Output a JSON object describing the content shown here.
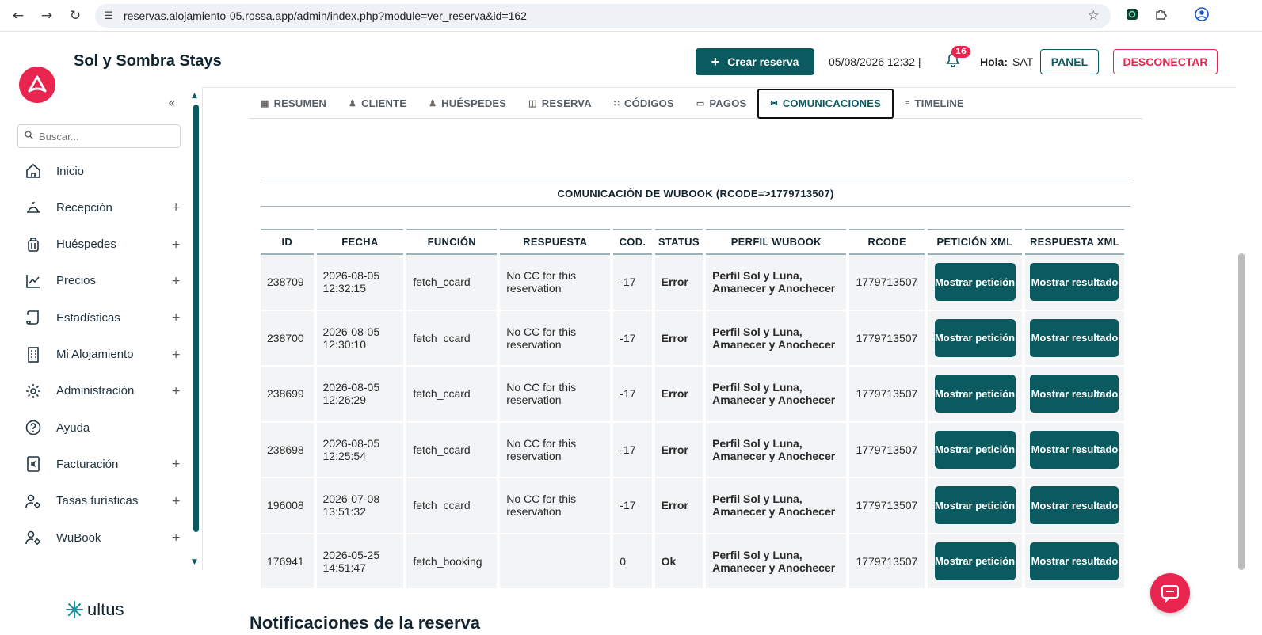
{
  "browser": {
    "url": "reservas.alojamiento-05.rossa.app/admin/index.php?module=ver_reserva&id=162"
  },
  "header": {
    "site_title": "Sol y Sombra Stays",
    "create_label": "Crear reserva",
    "datetime": "05/08/2026 12:32 |",
    "notifications_count": "16",
    "greeting": "Hola:",
    "user": "SAT",
    "panel_label": "PANEL",
    "logout_label": "DESCONECTAR",
    "colors": {
      "primary": "#0b5a60",
      "accent": "#e8254e"
    }
  },
  "sidebar": {
    "search_placeholder": "Buscar...",
    "items": [
      {
        "label": "Inicio",
        "icon": "home-icon",
        "expandable": false
      },
      {
        "label": "Recepción",
        "icon": "reception-bell-icon",
        "expandable": true
      },
      {
        "label": "Huéspedes",
        "icon": "luggage-icon",
        "expandable": true
      },
      {
        "label": "Precios",
        "icon": "chart-line-icon",
        "expandable": true
      },
      {
        "label": "Estadísticas",
        "icon": "scroll-icon",
        "expandable": true
      },
      {
        "label": "Mi Alojamiento",
        "icon": "building-icon",
        "expandable": true
      },
      {
        "label": "Administración",
        "icon": "gear-icon",
        "expandable": true
      },
      {
        "label": "Ayuda",
        "icon": "help-circle-icon",
        "expandable": false
      },
      {
        "label": "Facturación",
        "icon": "euro-document-icon",
        "expandable": true
      },
      {
        "label": "Tasas turísticas",
        "icon": "user-gear-icon",
        "expandable": true
      },
      {
        "label": "WuBook",
        "icon": "user-gear-icon",
        "expandable": true
      }
    ],
    "plus_symbol": "+",
    "footer_brand": "ultus"
  },
  "tabs": [
    {
      "label": "RESUMEN",
      "icon": "grid-icon",
      "active": false
    },
    {
      "label": "CLIENTE",
      "icon": "user-icon",
      "active": false
    },
    {
      "label": "HUÉSPEDES",
      "icon": "users-icon",
      "active": false
    },
    {
      "label": "RESERVA",
      "icon": "calendar-icon",
      "active": false
    },
    {
      "label": "CÓDIGOS",
      "icon": "code-icon",
      "active": false
    },
    {
      "label": "PAGOS",
      "icon": "card-icon",
      "active": false
    },
    {
      "label": "COMUNICACIONES",
      "icon": "mail-icon",
      "active": true
    },
    {
      "label": "TIMELINE",
      "icon": "list-icon",
      "active": false
    }
  ],
  "communications": {
    "title": "COMUNICACIÓN DE WUBOOK (RCODE=>1779713507)",
    "columns": [
      "ID",
      "FECHA",
      "FUNCIÓN",
      "RESPUESTA",
      "COD.",
      "STATUS",
      "PERFIL WUBOOK",
      "RCODE",
      "PETICIÓN XML",
      "RESPUESTA XML"
    ],
    "request_button": "Mostrar petición",
    "result_button": "Mostrar resultado",
    "rows": [
      {
        "id": "238709",
        "date": "2026-08-05",
        "time": "12:32:15",
        "function": "fetch_ccard",
        "response": "No CC for this reservation",
        "code": "-17",
        "status": "Error",
        "profile": "Perfil Sol y Luna, Amanecer y Anochecer",
        "rcode": "1779713507"
      },
      {
        "id": "238700",
        "date": "2026-08-05",
        "time": "12:30:10",
        "function": "fetch_ccard",
        "response": "No CC for this reservation",
        "code": "-17",
        "status": "Error",
        "profile": "Perfil Sol y Luna, Amanecer y Anochecer",
        "rcode": "1779713507"
      },
      {
        "id": "238699",
        "date": "2026-08-05",
        "time": "12:26:29",
        "function": "fetch_ccard",
        "response": "No CC for this reservation",
        "code": "-17",
        "status": "Error",
        "profile": "Perfil Sol y Luna, Amanecer y Anochecer",
        "rcode": "1779713507"
      },
      {
        "id": "238698",
        "date": "2026-08-05",
        "time": "12:25:54",
        "function": "fetch_ccard",
        "response": "No CC for this reservation",
        "code": "-17",
        "status": "Error",
        "profile": "Perfil Sol y Luna, Amanecer y Anochecer",
        "rcode": "1779713507"
      },
      {
        "id": "196008",
        "date": "2026-07-08",
        "time": "13:51:32",
        "function": "fetch_ccard",
        "response": "No CC for this reservation",
        "code": "-17",
        "status": "Error",
        "profile": "Perfil Sol y Luna, Amanecer y Anochecer",
        "rcode": "1779713507"
      },
      {
        "id": "176941",
        "date": "2026-05-25",
        "time": "14:51:47",
        "function": "fetch_booking",
        "response": "",
        "code": "0",
        "status": "Ok",
        "profile": "Perfil Sol y Luna, Amanecer y Anochecer",
        "rcode": "1779713507"
      }
    ]
  },
  "notifications_title": "Notificaciones de la reserva"
}
